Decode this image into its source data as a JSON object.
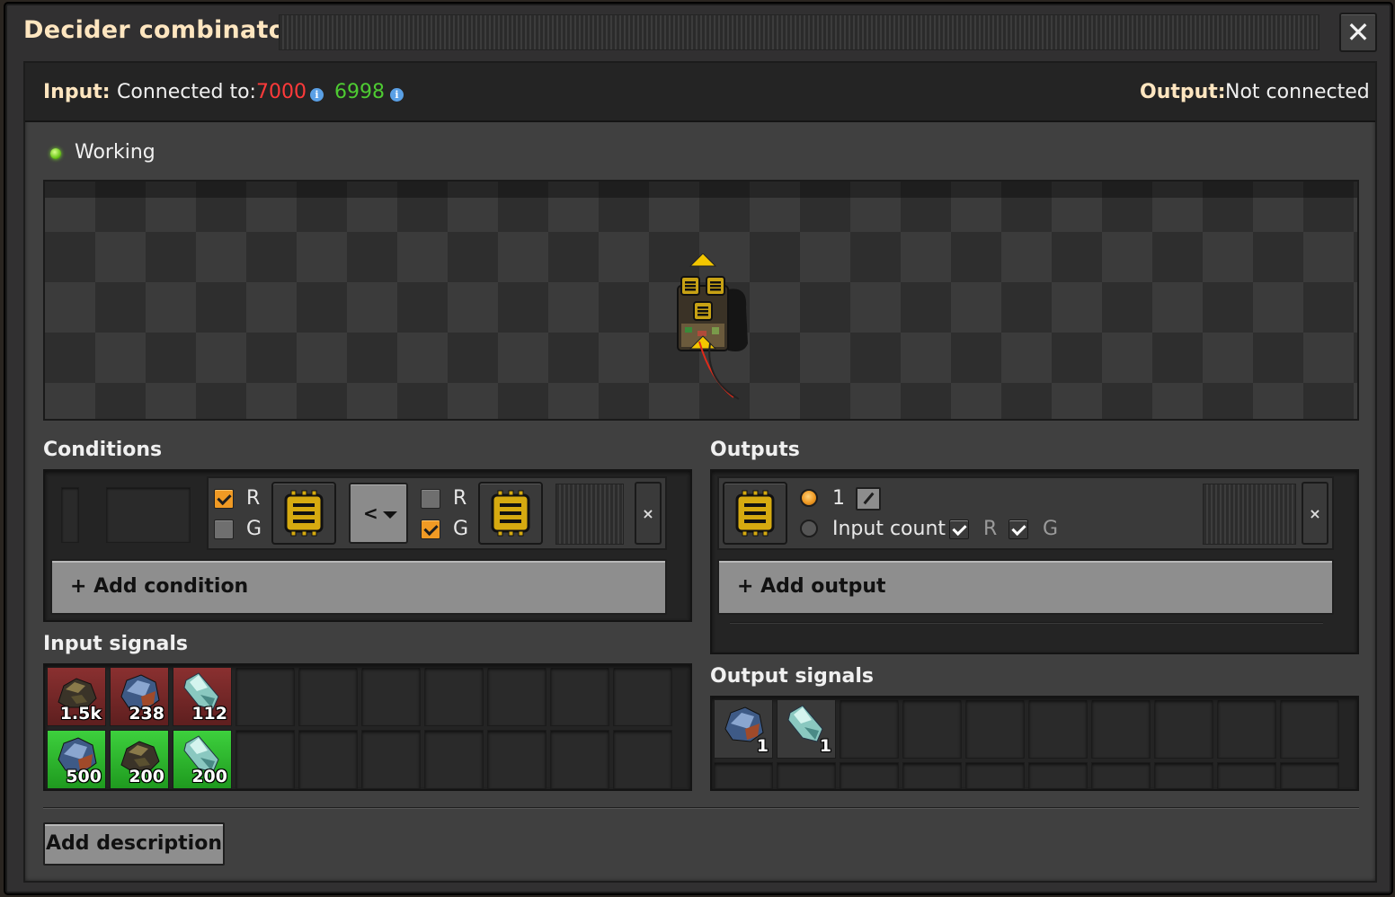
{
  "window": {
    "title": "Decider combinator",
    "close_icon": "close-icon"
  },
  "connections": {
    "input_label": "Input:",
    "connected_to_label": "Connected to:",
    "red_network": "7000",
    "green_network": "6998",
    "info_icon": "i",
    "output_label": "Output:",
    "output_value": "Not connected",
    "colors": {
      "red": "#ff3a3a",
      "green": "#4ecb32"
    }
  },
  "status": {
    "text": "Working",
    "color": "#6ec81c"
  },
  "conditions": {
    "title": "Conditions",
    "row": {
      "left": {
        "r_label": "R",
        "g_label": "G",
        "r_checked": true,
        "g_checked": false,
        "signal_icon": "circuit-chip-icon"
      },
      "comparator": "<",
      "right": {
        "r_label": "R",
        "g_label": "G",
        "r_checked": false,
        "g_checked": true,
        "signal_icon": "circuit-chip-icon"
      },
      "remove_label": "×"
    },
    "add_label": "+ Add condition"
  },
  "outputs": {
    "title": "Outputs",
    "row": {
      "signal_icon": "circuit-chip-icon",
      "constant_value": "1",
      "input_count_label": "Input count",
      "mode_selected": "constant",
      "r_label": "R",
      "g_label": "G",
      "r_checked": true,
      "g_checked": true,
      "remove_label": "×"
    },
    "add_label": "+ Add output"
  },
  "input_signals": {
    "title": "Input signals",
    "red": [
      {
        "item": "coal",
        "value": "1.5k"
      },
      {
        "item": "iron-ore",
        "value": "238"
      },
      {
        "item": "crystal",
        "value": "112"
      }
    ],
    "green": [
      {
        "item": "iron-ore",
        "value": "500"
      },
      {
        "item": "coal",
        "value": "200"
      },
      {
        "item": "crystal",
        "value": "200"
      }
    ]
  },
  "output_signals": {
    "title": "Output signals",
    "items": [
      {
        "item": "iron-ore",
        "value": "1"
      },
      {
        "item": "crystal",
        "value": "1"
      }
    ]
  },
  "footer": {
    "add_description_label": "Add description"
  }
}
